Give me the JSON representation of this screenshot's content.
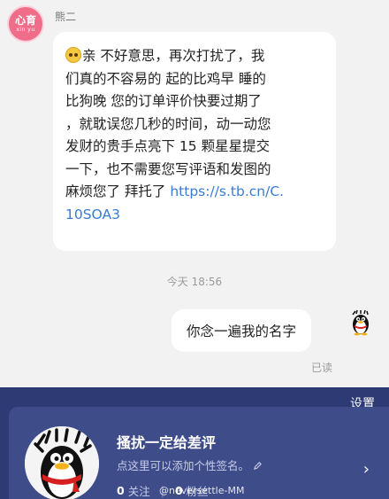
{
  "chat": {
    "contact_avatar_logo": "心育",
    "contact_avatar_sub": "xin yu",
    "contact_name": "熊二",
    "incoming_message": {
      "lines": [
        "亲 不好意思，再次打扰了，我",
        "们真的不容易的 起的比鸡早 睡的",
        "比狗晚 您的订单评价快要过期了",
        "，就耽误您几秒的时间，动一动您",
        "发财的贵手点亮下 15 颗星星提交",
        "一下，也不需要您写评语和发图的",
        " 麻烦您了 拜托了 "
      ],
      "link_part1": "https://s.tb.cn/C.",
      "link_part2": "10SOA3"
    },
    "timestamp": "今天 18:56",
    "outgoing_message": "你念一遍我的名字",
    "read_status": "已读"
  },
  "profile": {
    "settings_label": "设置",
    "name": "搔扰一定给差评",
    "signature": "点这里可以添加个性签名。",
    "following_count": "0",
    "following_label": "关注",
    "followers_count": "0",
    "followers_label": "粉丝"
  },
  "watermark": "@neversettle-MM",
  "colors": {
    "chat_bg": "#f2f2f2",
    "bubble": "#ffffff",
    "link": "#3a7bd5",
    "profile_bg": "#2d3a73",
    "profile_card": "#3e4c8a",
    "contact_avatar": "#f06d8a"
  }
}
